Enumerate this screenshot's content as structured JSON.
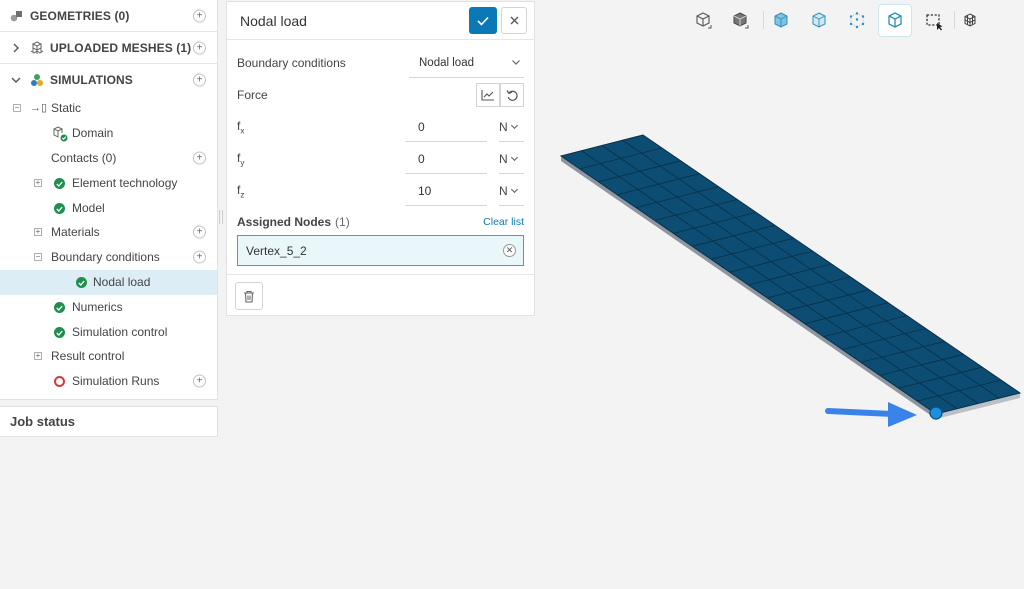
{
  "tree": {
    "sections": {
      "geometries": {
        "label": "GEOMETRIES (0)",
        "icon": "geometries-icon"
      },
      "uploaded_meshes": {
        "label": "UPLOADED MESHES (1)",
        "icon": "meshes-icon"
      },
      "simulations": {
        "label": "SIMULATIONS",
        "icon": "simulations-icon"
      }
    },
    "items": {
      "static": "Static",
      "domain": "Domain",
      "contacts": "Contacts (0)",
      "element_technology": "Element technology",
      "model": "Model",
      "materials": "Materials",
      "boundary_conditions": "Boundary conditions",
      "nodal_load": "Nodal load",
      "numerics": "Numerics",
      "simulation_control": "Simulation control",
      "result_control": "Result control",
      "simulation_runs": "Simulation Runs"
    }
  },
  "job_status": "Job status",
  "nodal_panel": {
    "title": "Nodal load",
    "bc_label": "Boundary conditions",
    "bc_value": "Nodal load",
    "force_label": "Force",
    "components": [
      {
        "name": "f",
        "sub": "x",
        "value": "0",
        "unit": "N"
      },
      {
        "name": "f",
        "sub": "y",
        "value": "0",
        "unit": "N"
      },
      {
        "name": "f",
        "sub": "z",
        "value": "10",
        "unit": "N"
      }
    ],
    "assigned_label": "Assigned Nodes",
    "assigned_count": "(1)",
    "clear_label": "Clear list",
    "node": "Vertex_5_2"
  },
  "colors": {
    "accent": "#0b79b5",
    "mesh": "#0d4d73",
    "mesh_grid": "#0a2f46",
    "success": "#1e8f4e",
    "error": "#d63a3a",
    "arrow": "#3a83ea"
  },
  "toolbar_icons": [
    "cube-wireframe-icon",
    "cube-solid-icon",
    "cube-blue-icon",
    "cube-edges-icon",
    "cube-points-icon",
    "cube-surface-icon",
    "box-select-icon",
    "mesh-settings-icon"
  ]
}
